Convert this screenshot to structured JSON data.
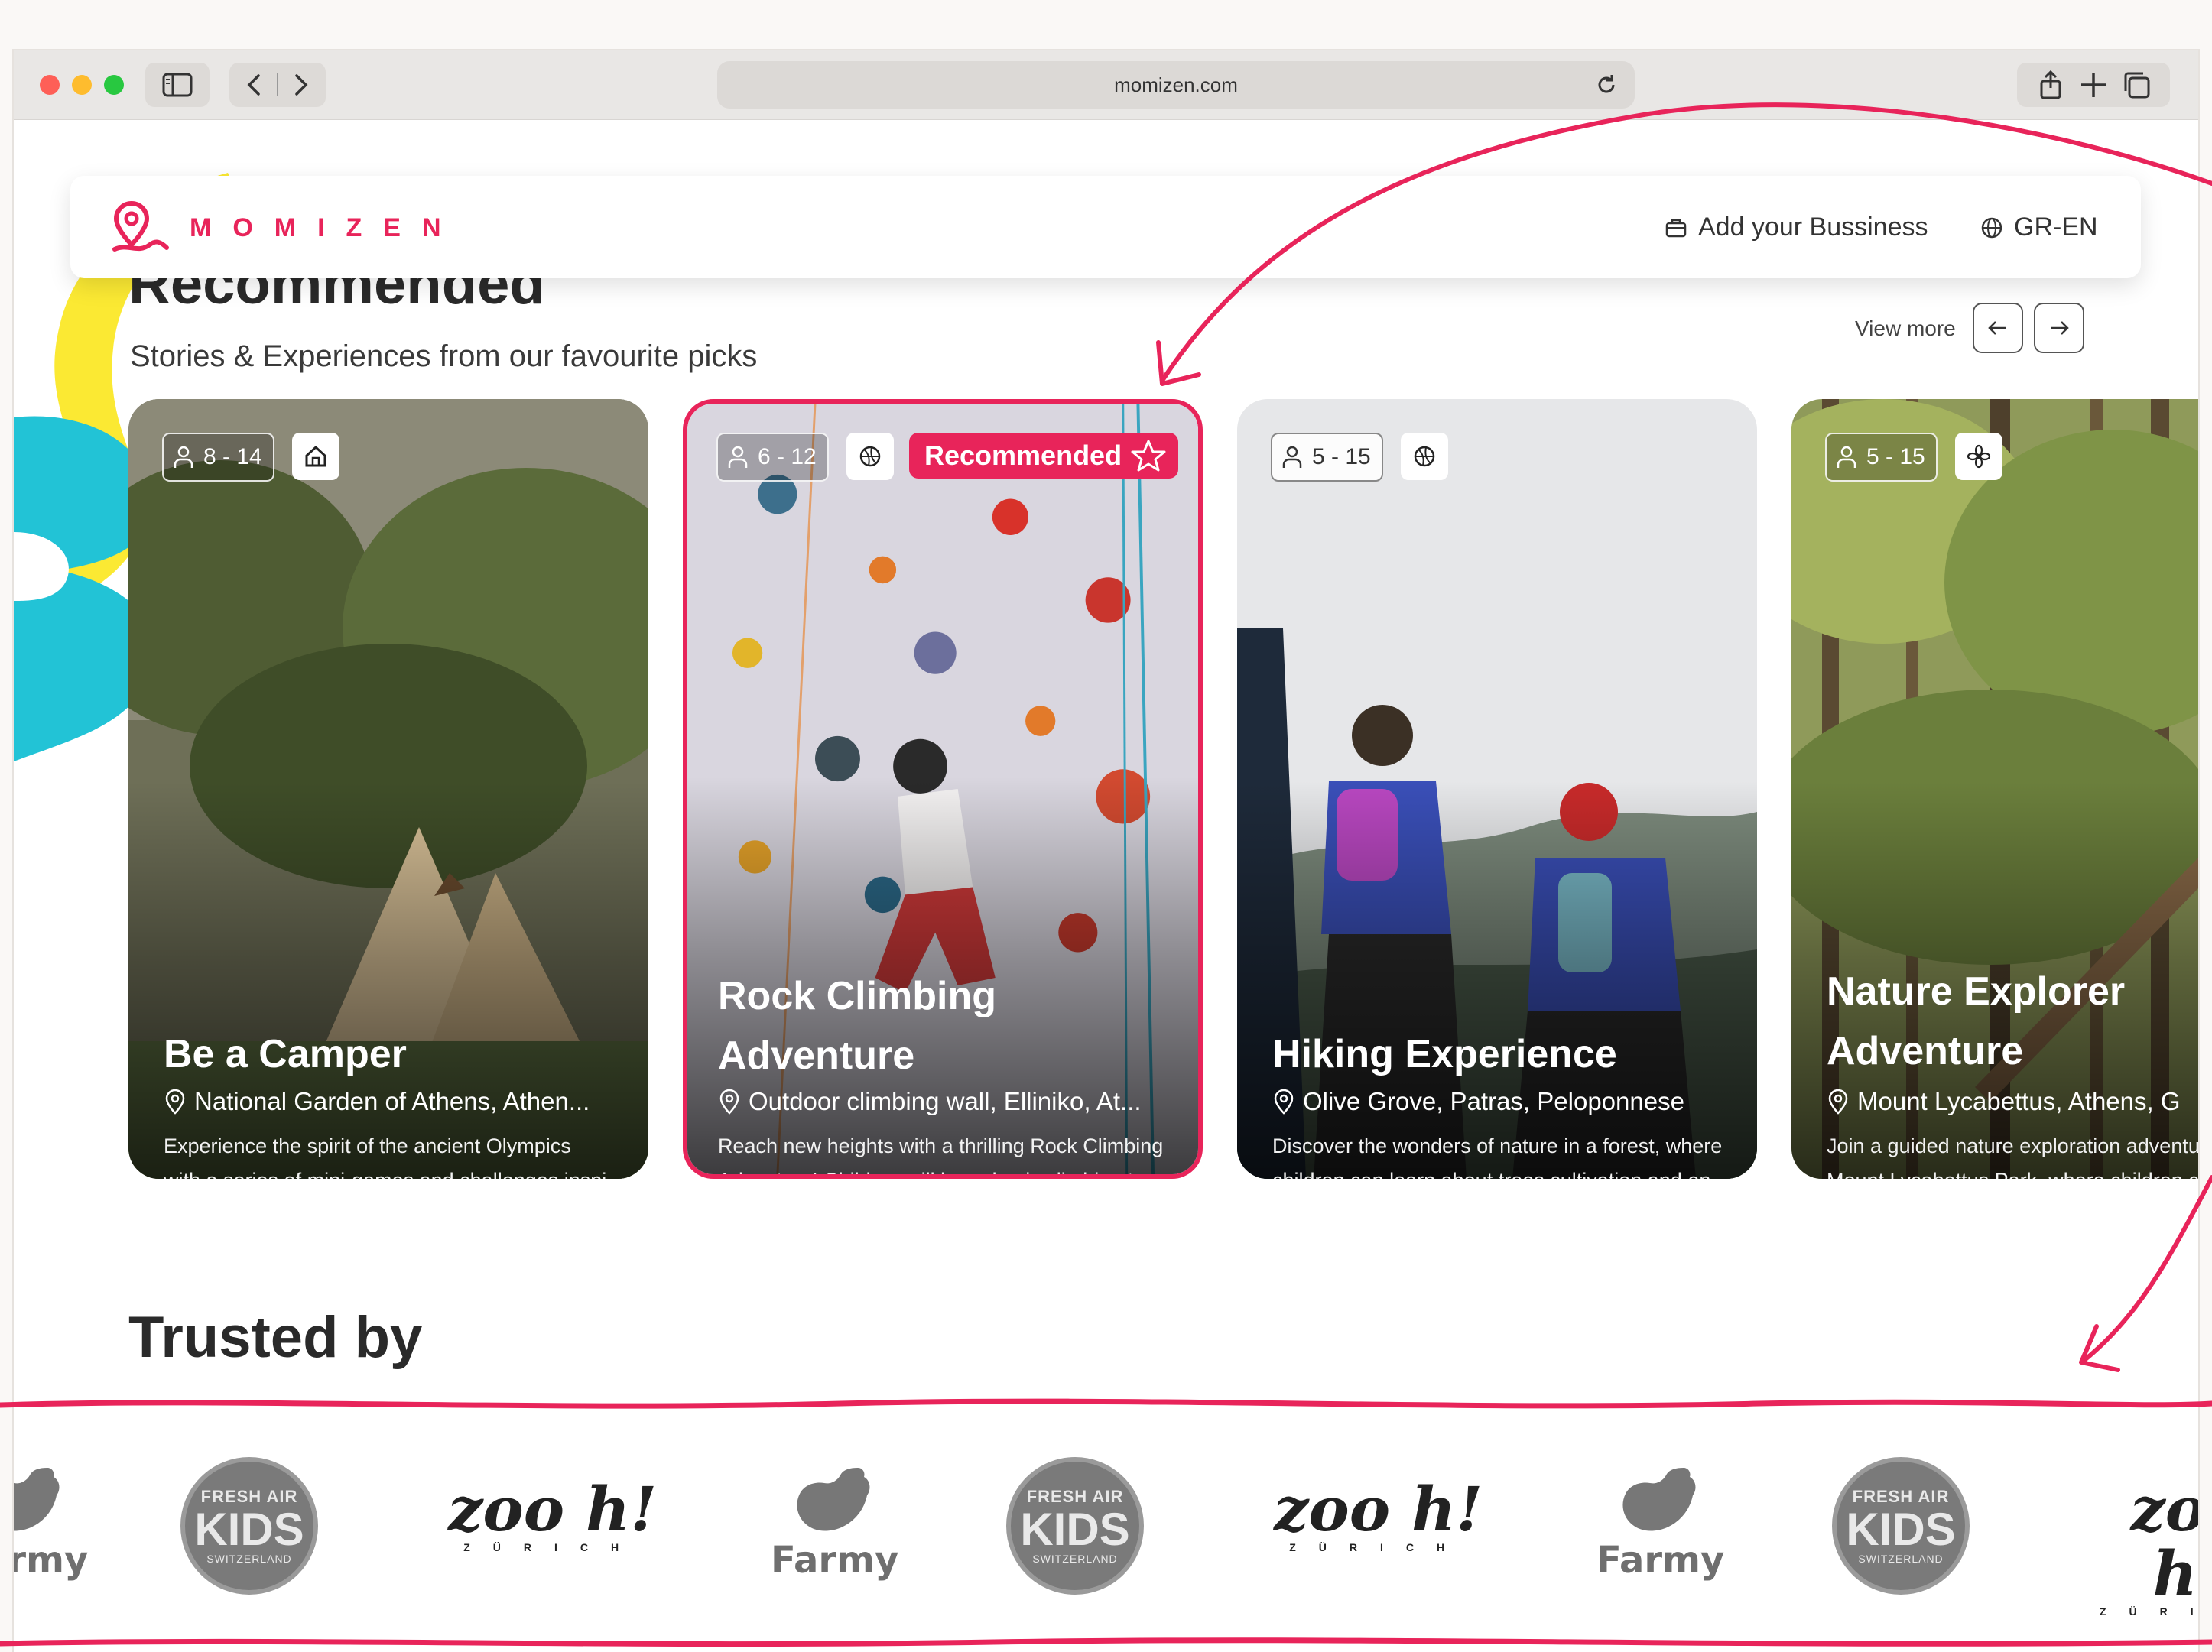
{
  "browser": {
    "url": "momizen.com"
  },
  "nav": {
    "brand": "MOMIZEN",
    "add_business": "Add your Bussiness",
    "language": "GR-EN"
  },
  "recommended": {
    "title": "Recommended",
    "subtitle": "Stories & Experiences from our favourite picks",
    "view_more": "View more"
  },
  "cards": [
    {
      "age": "8 - 14",
      "category_icon": "house-icon",
      "title_line1": "Be a Camper",
      "title_line2": "",
      "location": "National Garden of Athens, Athen...",
      "desc_line1": "Experience the spirit of the ancient Olympics",
      "desc_line2": "with a series of mini-games and challenges inspi..."
    },
    {
      "age": "6 - 12",
      "category_icon": "ball-icon",
      "badge": "Recommended",
      "title_line1": "Rock Climbing",
      "title_line2": "Adventure",
      "location": "Outdoor climbing wall, Elliniko, At...",
      "desc_line1": "Reach new heights with a thrilling Rock Climbing",
      "desc_line2": "Adventure! Children will learn basic climbing tec..."
    },
    {
      "age": "5 - 15",
      "category_icon": "ball-icon",
      "title_line1": "Hiking Experience",
      "title_line2": "",
      "location": "Olive Grove, Patras, Peloponnese",
      "desc_line1": "Discover the wonders of nature in a forest, where",
      "desc_line2": "children can learn about trees cultivation and en..."
    },
    {
      "age": "5 - 15",
      "category_icon": "flower-icon",
      "title_line1": "Nature Explorer",
      "title_line2": "Adventure",
      "location": "Mount Lycabettus, Athens, G",
      "desc_line1": "Join a guided nature exploration adventur",
      "desc_line2": "Mount Lycabettus Park, where children c"
    }
  ],
  "trusted": {
    "title": "Trusted by",
    "fresh_air": {
      "line1": "FRESH AIR",
      "line2": "KIDS",
      "line3": "SWITZERLAND"
    },
    "zooh": {
      "big": "zoo h!",
      "small": "ZÜRICH"
    },
    "farmy": {
      "name": "Farmy"
    }
  },
  "colors": {
    "brand": "#e8245a",
    "annotation": "#e8245a"
  }
}
